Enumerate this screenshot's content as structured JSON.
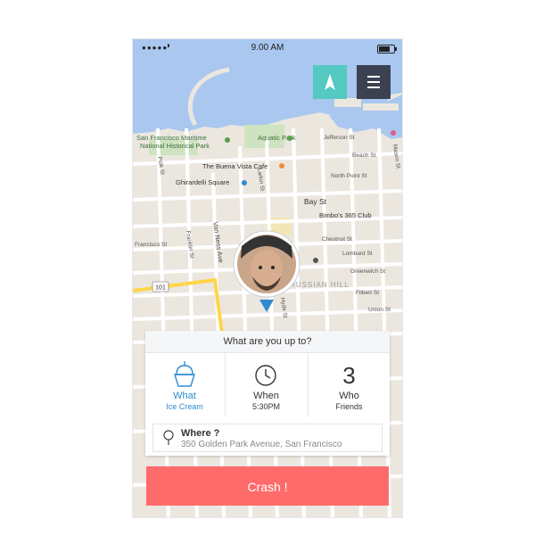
{
  "status_bar": {
    "time": "9.00 AM"
  },
  "map": {
    "labels": {
      "sf_maritime_1": "San Francisco Maritime",
      "sf_maritime_2": "National Historical Park",
      "aquatic_park": "Aquatic Park",
      "buena_vista": "The Buena Vista Cafe",
      "ghirardelli": "Ghirardelli Square",
      "bay_st": "Bay St",
      "bimbos": "Bimbo's 365 Club",
      "chestnut": "Chestnut St",
      "francisco": "Francisco St",
      "lombard": "Lombard St",
      "greenwich": "Greenwich St",
      "filbert": "Filbert St",
      "union": "Union St",
      "beach": "Beach St",
      "north_point": "North Point St",
      "jefferson": "Jefferson St",
      "van_ness": "Van Ness Ave",
      "franklin": "Franklin St",
      "larkin": "Larkin St",
      "polk": "Polk St",
      "hyde": "Hyde St",
      "russian_hill": "RUSSIAN HILL",
      "route": "101",
      "mason": "Mason St"
    }
  },
  "card": {
    "title": "What are you up to?",
    "what": {
      "title": "What",
      "value": "Ice Cream"
    },
    "when": {
      "title": "When",
      "value": "5:30PM"
    },
    "who": {
      "count": "3",
      "title": "Who",
      "value": "Friends"
    },
    "where": {
      "label": "Where ?",
      "address": "350 Golden Park Avenue, San Francisco"
    }
  },
  "action": {
    "label": "Crash !"
  },
  "colors": {
    "accent_teal": "#53c9c2",
    "menu_dark": "#3b4151",
    "crash_red": "#ff6b6b",
    "accent_blue": "#2e8bd0"
  }
}
